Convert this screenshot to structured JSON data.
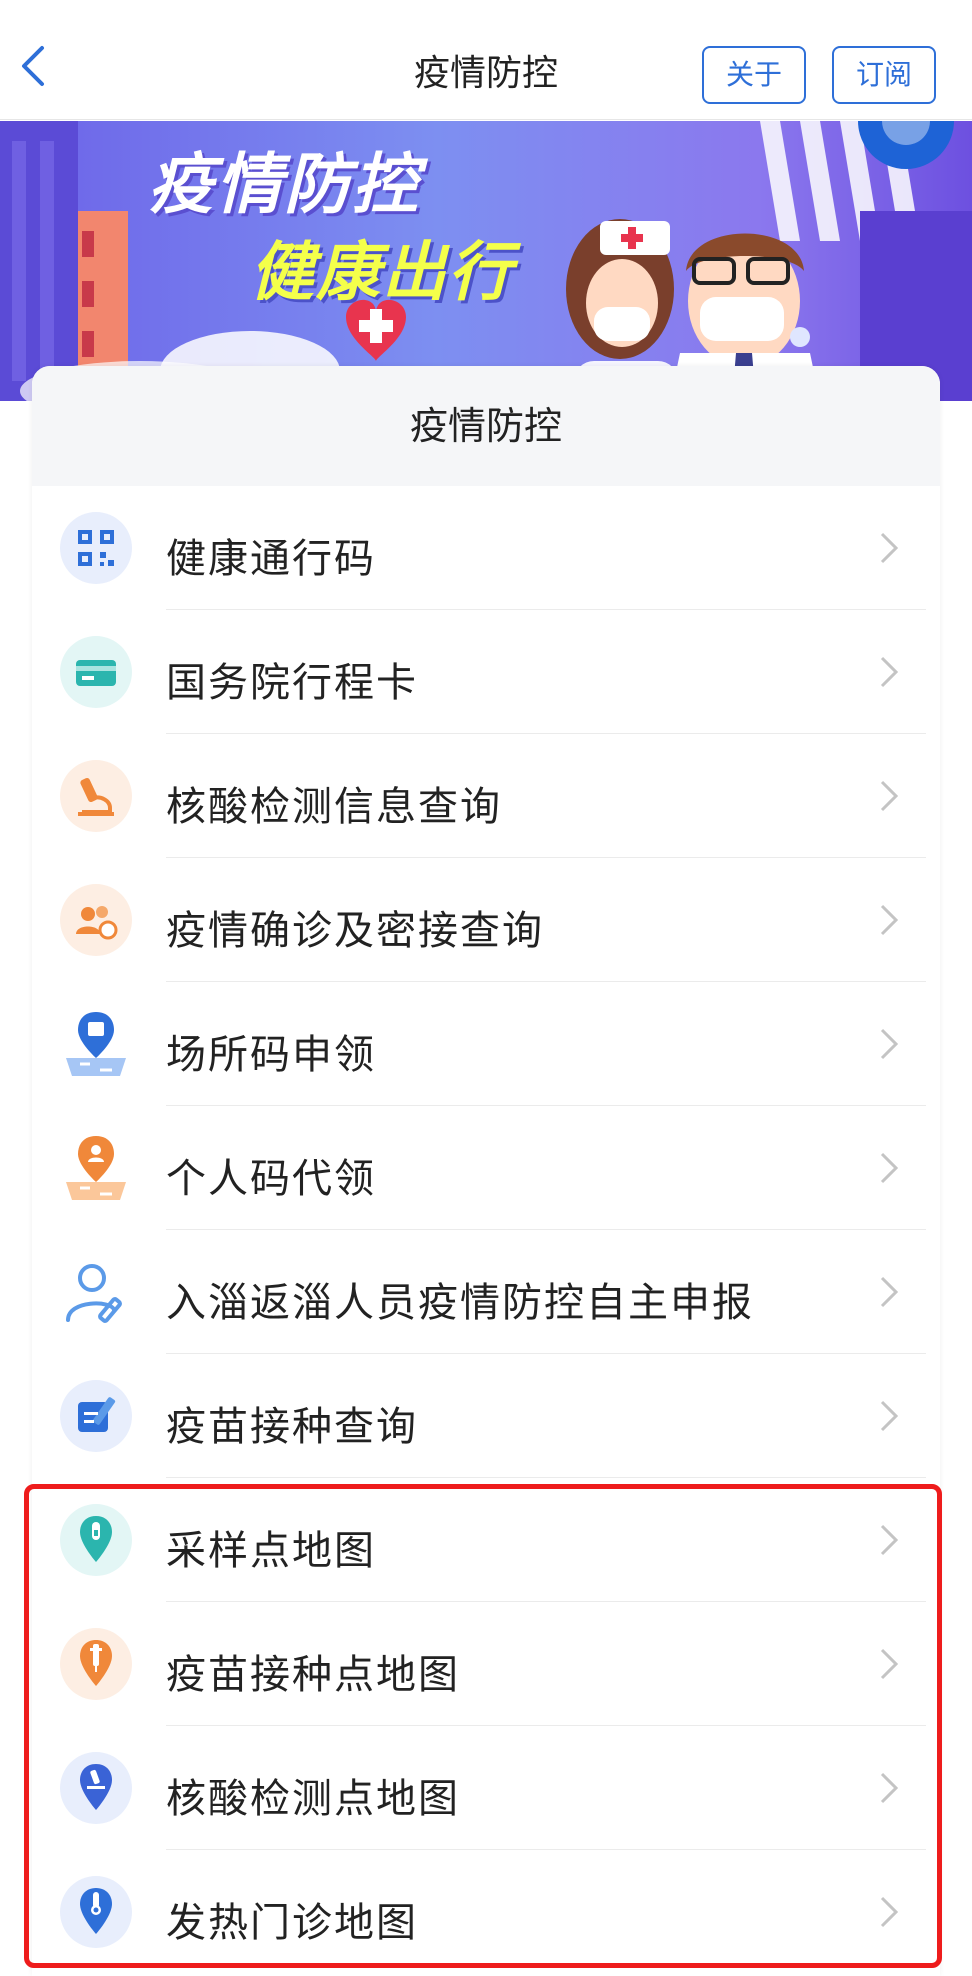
{
  "navbar": {
    "title": "疫情防控",
    "about_label": "关于",
    "subscribe_label": "订阅"
  },
  "banner": {
    "line1": "疫情防控",
    "line2": "健康出行"
  },
  "card": {
    "title": "疫情防控"
  },
  "items": [
    {
      "label": "健康通行码",
      "icon": "qr-code-icon"
    },
    {
      "label": "国务院行程卡",
      "icon": "travel-card-icon"
    },
    {
      "label": "核酸检测信息查询",
      "icon": "microscope-icon"
    },
    {
      "label": "疫情确诊及密接查询",
      "icon": "people-search-icon"
    },
    {
      "label": "场所码申领",
      "icon": "venue-code-location-icon"
    },
    {
      "label": "个人码代领",
      "icon": "personal-code-location-icon"
    },
    {
      "label": "入淄返淄人员疫情防控自主申报",
      "icon": "person-edit-icon"
    },
    {
      "label": "疫苗接种查询",
      "icon": "vaccine-record-icon"
    },
    {
      "label": "采样点地图",
      "icon": "sampling-point-map-icon"
    },
    {
      "label": "疫苗接种点地图",
      "icon": "vaccine-point-map-icon"
    },
    {
      "label": "核酸检测点地图",
      "icon": "test-point-map-icon"
    },
    {
      "label": "发热门诊地图",
      "icon": "fever-clinic-map-icon"
    }
  ],
  "colors": {
    "accent": "#2e6fd8",
    "highlight": "#ee1c1c"
  }
}
